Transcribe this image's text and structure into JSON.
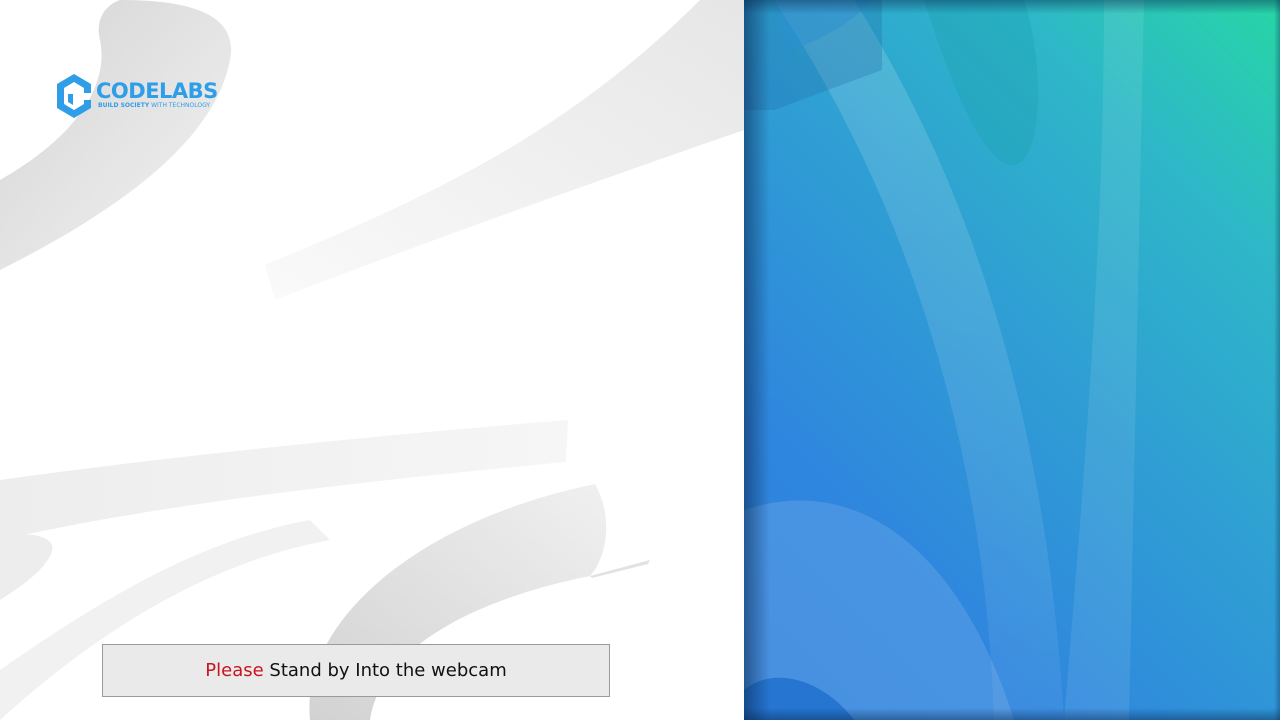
{
  "logo": {
    "name": "CODELABS",
    "tagline_bold": "BUILD SOCIETY",
    "tagline_rest": " WITH TECHNOLOGY",
    "brand_color": "#2f9ee8",
    "icon": "hexagon-logo-icon"
  },
  "caption": {
    "accent_word": "Please",
    "text": " Stand by Into the webcam",
    "accent_color": "#c8141e"
  },
  "webcam_panel": {
    "gradient_colors": [
      "#27d6a5",
      "#2eb7c8",
      "#2f9dd4",
      "#2f80dc"
    ]
  }
}
